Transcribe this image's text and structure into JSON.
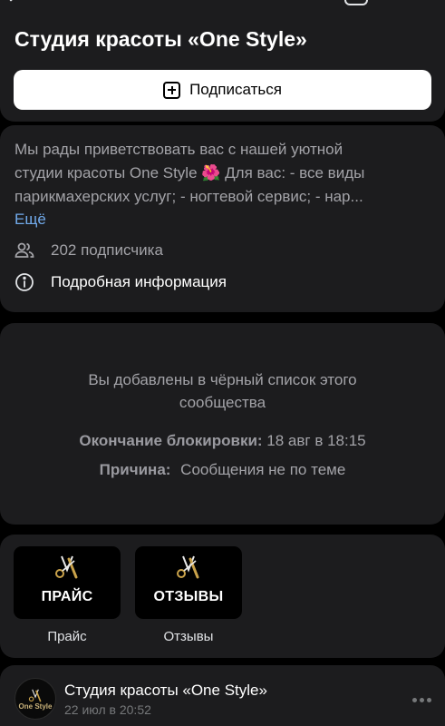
{
  "header": {
    "title": "Студия красоты  «One Style»",
    "subscribe_label": "Подписаться"
  },
  "about": {
    "description_lines": [
      "Мы рады приветствовать вас с нашей уютной",
      "студии красоты One Style 🌺 Для вас:  - все виды",
      "парикмахерских услуг;  - ногтевой сервис;  - нар..."
    ],
    "more_label": "Ещё",
    "followers": "202 подписчика",
    "details_label": "Подробная информация"
  },
  "blacklist": {
    "message": "Вы добавлены в чёрный список этого сообщества",
    "end_label": "Окончание блокировки:",
    "end_value": "18 авг в 18:15",
    "reason_label": "Причина:",
    "reason_value": "Сообщения не по теме"
  },
  "links": [
    {
      "tile_text": "ПРАЙС",
      "caption": "Прайс"
    },
    {
      "tile_text": "ОТЗЫВЫ",
      "caption": "Отзывы"
    }
  ],
  "post": {
    "author": "Студия красоты  «One Style»",
    "date": "22 июл в 20:52",
    "avatar_text": "One Style"
  },
  "colors": {
    "card_bg": "#1c1c1e",
    "link": "#71aaeb",
    "secondary_text": "#a3a3a8"
  }
}
